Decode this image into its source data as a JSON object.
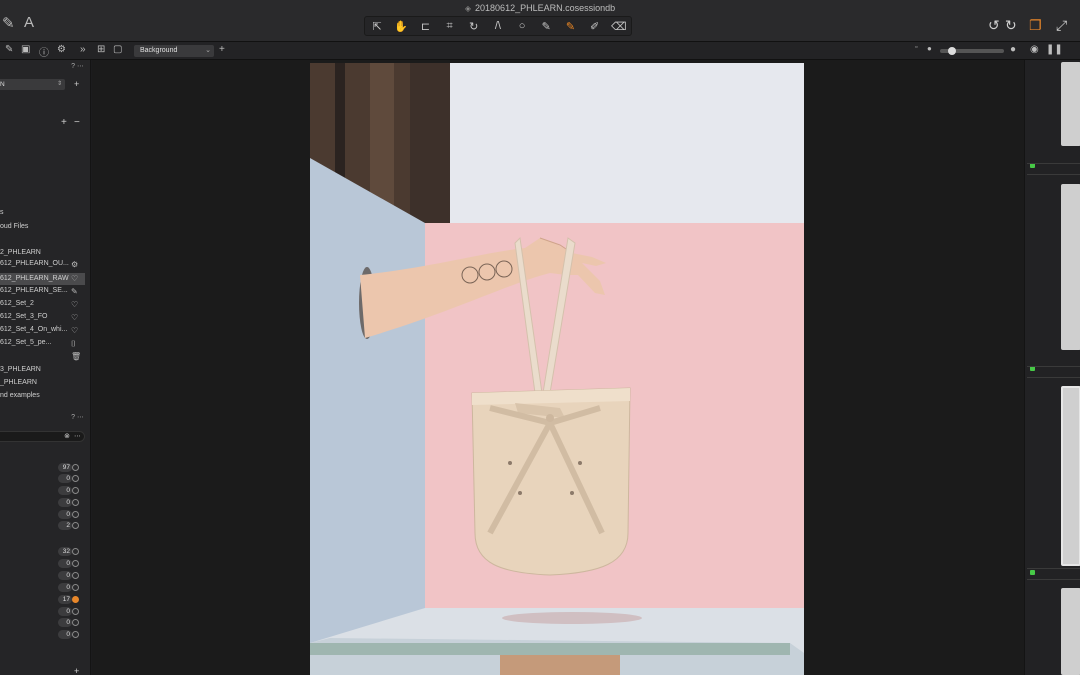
{
  "window": {
    "title": "20180612_PHLEARN.cosessiondb"
  },
  "toolbar": {
    "tools": [
      "select",
      "hand",
      "straighten",
      "crop",
      "rotate",
      "keystone",
      "spot",
      "brush",
      "draw-mask",
      "erase",
      "gradient"
    ],
    "active_tool": "draw-mask",
    "accent_color": "#f08a24"
  },
  "subbar": {
    "layer_select": "Background"
  },
  "library": {
    "collections": [
      {
        "label": "s"
      },
      {
        "label": "oud Files"
      }
    ],
    "session_folder": "2_PHLEARN",
    "items": [
      {
        "label": "612_PHLEARN_OU...",
        "icon": "gear-icon"
      },
      {
        "label": "612_PHLEARN_RAW",
        "icon": "heart-icon",
        "selected": true
      },
      {
        "label": "612_PHLEARN_SE...",
        "icon": "edit-icon"
      },
      {
        "label": "612_Set_2",
        "icon": "heart-icon"
      },
      {
        "label": "612_Set_3_FO",
        "icon": "heart-icon"
      },
      {
        "label": "612_Set_4_On_whi...",
        "icon": "heart-icon"
      },
      {
        "label": "612_Set_5_pe...",
        "icon": "camera-icon"
      },
      {
        "label": "",
        "icon": "trash-icon"
      }
    ],
    "other": [
      {
        "label": "3_PHLEARN"
      },
      {
        "label": "_PHLEARN"
      },
      {
        "label": "nd examples"
      }
    ],
    "dropdown": "N"
  },
  "filters": {
    "group1": [
      "97",
      "0",
      "0",
      "0",
      "0",
      "2"
    ],
    "group2": [
      "32",
      "0",
      "0",
      "0",
      "17",
      "0",
      "0",
      "0"
    ]
  },
  "photo": {
    "description_colors": {
      "wall_pink": "#f0c3c5",
      "wall_blue": "#c6d3e0",
      "bag": "#e5d2b8",
      "skin": "#e9c3a8"
    }
  }
}
